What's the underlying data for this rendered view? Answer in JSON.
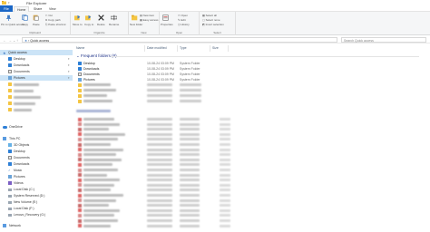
{
  "window": {
    "title": "File Explorer"
  },
  "tabs": [
    "File",
    "Home",
    "Share",
    "View"
  ],
  "ribbon": {
    "groups": [
      {
        "label": "Clipboard",
        "buttons": [
          "Pin to Quick access",
          "Copy",
          "Paste",
          "Cut",
          "Copy path",
          "Paste shortcut"
        ]
      },
      {
        "label": "Organize",
        "buttons": [
          "Move to",
          "Copy to",
          "Delete",
          "Rename"
        ]
      },
      {
        "label": "New",
        "buttons": [
          "New folder",
          "New item",
          "Easy access"
        ]
      },
      {
        "label": "Open",
        "buttons": [
          "Properties",
          "Open",
          "Edit",
          "History"
        ]
      },
      {
        "label": "Select",
        "buttons": [
          "Select all",
          "Select none",
          "Invert selection"
        ]
      }
    ]
  },
  "address": {
    "path": "Quick access",
    "search_placeholder": "Search Quick access"
  },
  "sidebar": {
    "quick_access": "Quick access",
    "pinned": [
      "Desktop",
      "Downloads",
      "Documents",
      "Pictures"
    ],
    "blurred_count": 6,
    "onedrive": "OneDrive",
    "this_pc": "This PC",
    "pc_items": [
      "3D Objects",
      "Desktop",
      "Documents",
      "Downloads",
      "Music",
      "Pictures",
      "Videos",
      "Local Disk (C:)",
      "System Reserved (D:)",
      "New Volume (E:)",
      "Local Disk (F:)",
      "Lenovo_Recovery (G:)"
    ],
    "network": "Network"
  },
  "columns": [
    "Name",
    "Date modified",
    "Type",
    "Size"
  ],
  "frequent": {
    "header": "Frequent folders (8)",
    "rows": [
      {
        "name": "Desktop",
        "date": "10-08-24 03:09 PM",
        "type": "System Folder"
      },
      {
        "name": "Downloads",
        "date": "10-08-24 03:09 PM",
        "type": "System Folder"
      },
      {
        "name": "Documents",
        "date": "10-08-24 03:09 PM",
        "type": "System Folder"
      },
      {
        "name": "Pictures",
        "date": "10-08-24 03:09 PM",
        "type": "System Folder"
      }
    ]
  },
  "colors": {
    "accent": "#1a66c6",
    "selected": "#cce4f7",
    "folder": "#f4c542",
    "group_header": "#1e3287"
  }
}
